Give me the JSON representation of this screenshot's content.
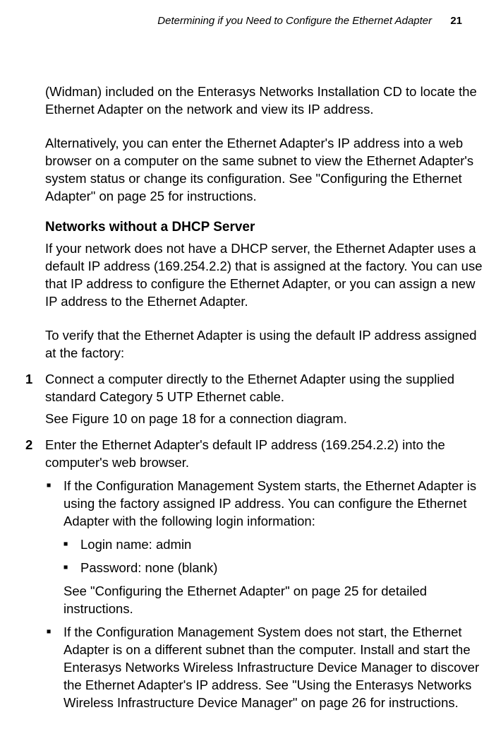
{
  "header": {
    "section": "Determining if you Need to Configure the Ethernet Adapter",
    "page": "21"
  },
  "body": {
    "p1": "(Widman) included on the Enterasys Networks Installation CD to locate the Ethernet Adapter on the network and view its IP address.",
    "p2": "Alternatively, you can enter the Ethernet Adapter's IP address into a web browser on a computer on the same subnet to view the Ethernet Adapter's system status or change its configuration. See \"Configuring the Ethernet Adapter\" on page 25 for instructions.",
    "h1": "Networks without a DHCP Server",
    "p3": "If your network does not have a DHCP server, the Ethernet Adapter uses a default IP address (169.254.2.2) that is assigned at the factory. You can use that IP address to configure the Ethernet Adapter, or you can assign a new IP address to the Ethernet Adapter.",
    "p4": "To verify that the Ethernet Adapter is using the default IP address assigned at the factory:",
    "steps": {
      "n1": "1",
      "s1a": "Connect a computer directly to the Ethernet Adapter using the supplied standard Category 5 UTP Ethernet cable.",
      "s1b": "See Figure 10 on page 18 for a connection diagram.",
      "n2": "2",
      "s2a": "Enter the Ethernet Adapter's default IP address (169.254.2.2) into the computer's web browser.",
      "b1": "If the Configuration Management System starts, the Ethernet Adapter is using the factory assigned IP address. You can configure the Ethernet Adapter with the following login information:",
      "b1a": "Login name: admin",
      "b1b": "Password: none (blank)",
      "b1c": "See \"Configuring the Ethernet Adapter\" on page 25 for detailed instructions.",
      "b2": "If the Configuration Management System does not start, the Ethernet Adapter is on a different subnet than the computer. Install and start the Enterasys Networks Wireless Infrastructure Device Manager to discover the Ethernet Adapter's IP address. See \"Using the Enterasys Networks Wireless Infrastructure Device Manager\" on page 26 for instructions."
    }
  }
}
